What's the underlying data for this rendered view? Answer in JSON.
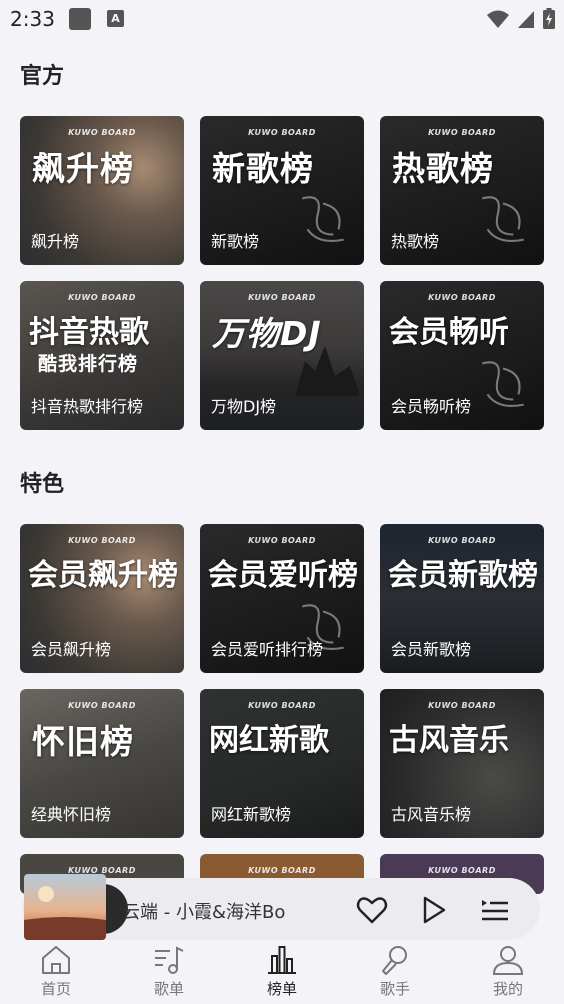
{
  "status": {
    "time": "2:33",
    "notif_letter": "A"
  },
  "sections": {
    "official": "官方",
    "featured": "特色"
  },
  "brand": "KUWO BOARD",
  "cards": [
    {
      "big": "飙升榜",
      "sub": "",
      "label": "飙升榜"
    },
    {
      "big": "新歌榜",
      "sub": "",
      "label": "新歌榜"
    },
    {
      "big": "热歌榜",
      "sub": "",
      "label": "热歌榜"
    },
    {
      "big": "抖音热歌",
      "sub": "酷我排行榜",
      "label": "抖音热歌排行榜"
    },
    {
      "big": "万物DJ",
      "sub": "",
      "label": "万物DJ榜"
    },
    {
      "big": "会员畅听",
      "sub": "",
      "label": "会员畅听榜"
    },
    {
      "big": "会员飙升榜",
      "sub": "",
      "label": "会员飙升榜"
    },
    {
      "big": "会员爱听榜",
      "sub": "",
      "label": "会员爱听排行榜"
    },
    {
      "big": "会员新歌榜",
      "sub": "",
      "label": "会员新歌榜"
    },
    {
      "big": "怀旧榜",
      "sub": "",
      "label": "经典怀旧榜"
    },
    {
      "big": "网红新歌",
      "sub": "",
      "label": "网红新歌榜"
    },
    {
      "big": "古风音乐",
      "sub": "",
      "label": "古风音乐榜"
    }
  ],
  "player": {
    "song": "云端 - 小霞&海洋Bo"
  },
  "tabs": [
    {
      "label": "首页"
    },
    {
      "label": "歌单"
    },
    {
      "label": "榜单"
    },
    {
      "label": "歌手"
    },
    {
      "label": "我的"
    }
  ]
}
